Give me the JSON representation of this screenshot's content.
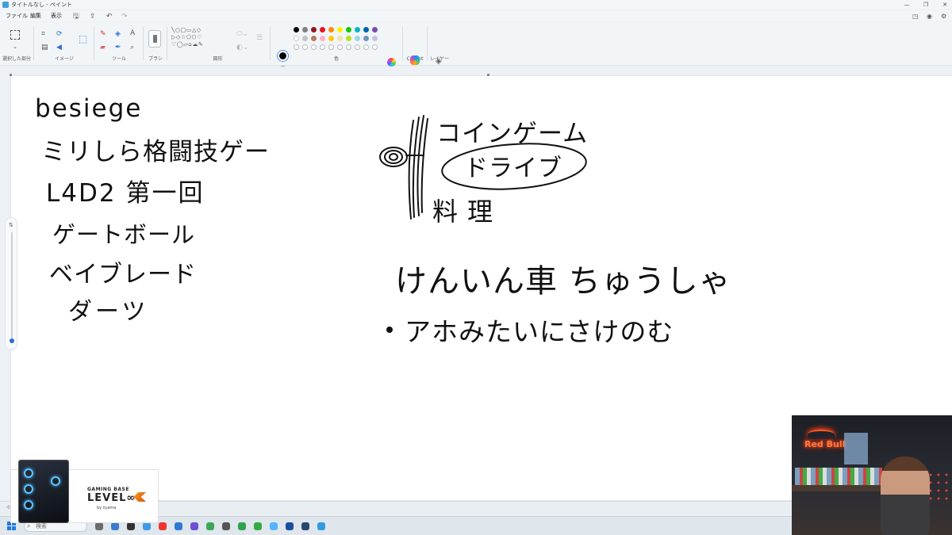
{
  "window": {
    "title": "タイトルなし - ペイント"
  },
  "menu": {
    "file": "ファイル",
    "edit": "編集",
    "view": "表示"
  },
  "ribbon": {
    "groups": {
      "selection": "選択した部分",
      "image": "イメージ",
      "tools": "ツール",
      "brushes": "ブラシ",
      "shapes": "図形",
      "colors": "色",
      "copilot": "Copilot",
      "layers": "レイヤー"
    },
    "shapes_glyphs": "╲○□▭△◇\n▷◇☆⬠⬡♡\n♡◯▱⌂☁✎",
    "palette_row1": [
      "#000000",
      "#808080",
      "#8b1a1a",
      "#e81123",
      "#ff8c00",
      "#fff100",
      "#16c60c",
      "#00b7c3",
      "#0063b1",
      "#744da9"
    ],
    "palette_row2": [
      "#ffffff",
      "#c3c3c3",
      "#b97a57",
      "#ffaec9",
      "#ffc90e",
      "#efe4b0",
      "#b5e61d",
      "#99d9ea",
      "#7092be",
      "#c8bfe7"
    ],
    "current_color": "#000000"
  },
  "canvas": {
    "left_list": [
      "besiege",
      "ミリしら格闘技ゲー",
      "L4D2 第一回",
      "ゲートボール",
      "ベイブレード",
      "ダーツ"
    ],
    "right_header": "コインゲーム",
    "drive": "ドライブ",
    "cooking": "料理",
    "mid_line": "けんいん車 ちゅうしゃ",
    "bullet_line": "アホみたいにさけのむ"
  },
  "taskbar": {
    "search_placeholder": "検索"
  },
  "ad": {
    "line1": "GAMING BASE",
    "line2": "LEVEL∞",
    "line3": "by iiyama"
  },
  "webcam": {
    "neon_text": "Red Bull"
  }
}
